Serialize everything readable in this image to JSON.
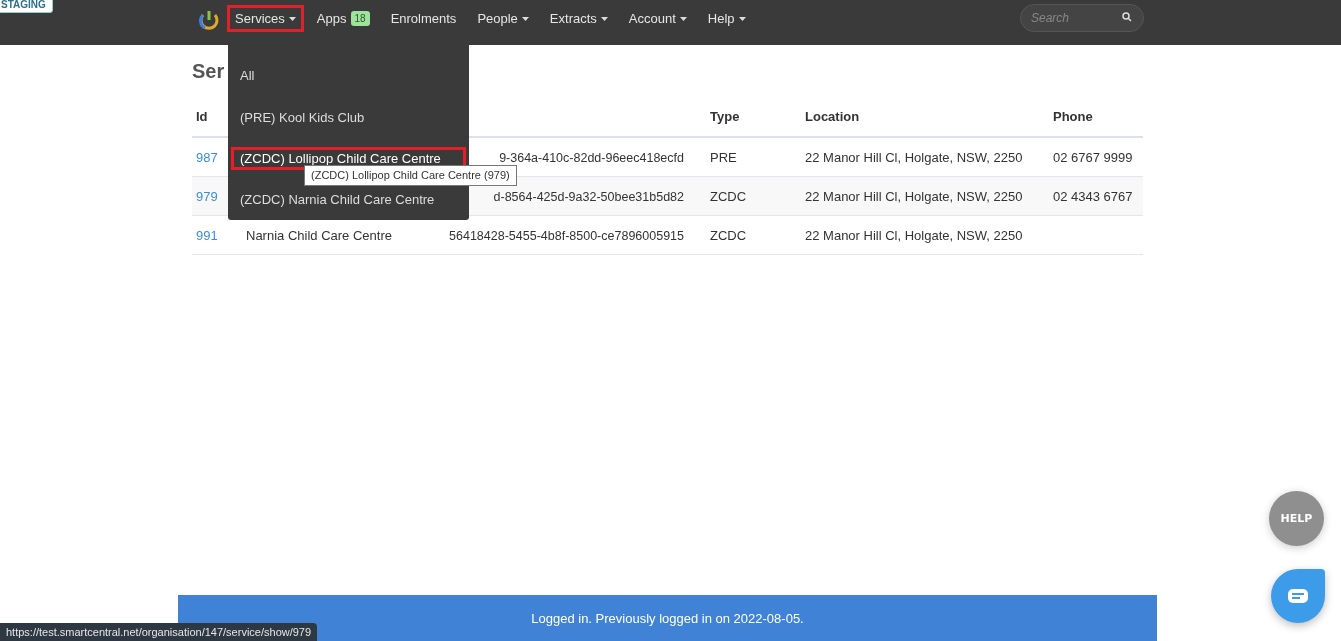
{
  "environment_badge": "STAGING",
  "nav": {
    "items": [
      {
        "label": "Services",
        "caret": true,
        "highlighted": true
      },
      {
        "label": "Apps",
        "badge": "18",
        "caret": false,
        "highlighted": false
      },
      {
        "label": "Enrolments",
        "caret": false,
        "highlighted": false
      },
      {
        "label": "People",
        "caret": true,
        "highlighted": false
      },
      {
        "label": "Extracts",
        "caret": true,
        "highlighted": false
      },
      {
        "label": "Account",
        "caret": true,
        "highlighted": false
      },
      {
        "label": "Help",
        "caret": true,
        "highlighted": false
      }
    ],
    "search": {
      "placeholder": "Search"
    }
  },
  "dropdown": {
    "items": [
      {
        "label": "All",
        "highlighted": false
      },
      {
        "label": "(PRE) Kool Kids Club",
        "highlighted": false
      },
      {
        "label": "(ZCDC) Lollipop Child Care Centre",
        "highlighted": true
      },
      {
        "label": "(ZCDC) Narnia Child Care Centre",
        "highlighted": false
      }
    ],
    "tooltip": "(ZCDC) Lollipop Child Care Centre (979)"
  },
  "page_title": "Ser",
  "table": {
    "columns": {
      "id": "Id",
      "type": "Type",
      "location": "Location",
      "phone": "Phone"
    },
    "rows": [
      {
        "id": "987",
        "uid": "9-364a-410c-82dd-96eec418ecfd",
        "type": "PRE",
        "location": "22 Manor Hill Cl, Holgate, NSW, 2250",
        "phone": "02 6767 9999"
      },
      {
        "id": "979",
        "uid": "d-8564-425d-9a32-50bee31b5d82",
        "type": "ZCDC",
        "location": "22 Manor Hill Cl, Holgate, NSW, 2250",
        "phone": "02 4343 6767"
      },
      {
        "id": "991",
        "name": "Narnia Child Care Centre",
        "uid": "56418428-5455-4b8f-8500-ce7896005915",
        "type": "ZCDC",
        "location": "22 Manor Hill Cl, Holgate, NSW, 2250"
      }
    ]
  },
  "footer": "Logged in. Previously logged in on 2022-08-05.",
  "status_url": "https://test.smartcentral.net/organisation/147/service/show/979",
  "help_button": "HELP"
}
